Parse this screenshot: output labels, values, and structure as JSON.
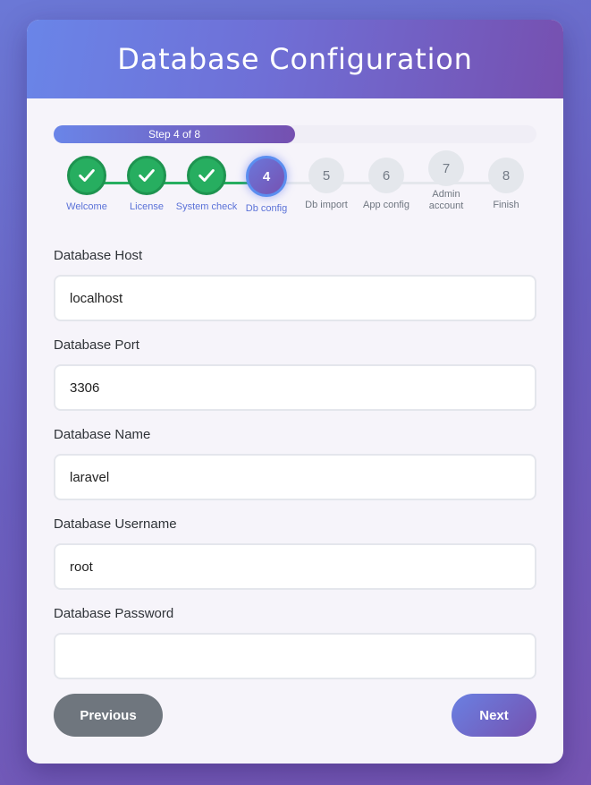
{
  "header": {
    "title": "Database Configuration"
  },
  "progress": {
    "text": "Step 4 of 8",
    "current": 4,
    "total": 8
  },
  "steps": [
    {
      "label": "Welcome",
      "number": "1",
      "state": "done"
    },
    {
      "label": "License",
      "number": "2",
      "state": "done"
    },
    {
      "label": "System check",
      "number": "3",
      "state": "done"
    },
    {
      "label": "Db config",
      "number": "4",
      "state": "active"
    },
    {
      "label": "Db import",
      "number": "5",
      "state": "pending"
    },
    {
      "label": "App config",
      "number": "6",
      "state": "pending"
    },
    {
      "label": "Admin account",
      "number": "7",
      "state": "pending"
    },
    {
      "label": "Finish",
      "number": "8",
      "state": "pending"
    }
  ],
  "form": {
    "host": {
      "label": "Database Host",
      "value": "localhost"
    },
    "port": {
      "label": "Database Port",
      "value": "3306"
    },
    "name": {
      "label": "Database Name",
      "value": "laravel"
    },
    "username": {
      "label": "Database Username",
      "value": "root"
    },
    "password": {
      "label": "Database Password",
      "value": ""
    }
  },
  "buttons": {
    "previous": "Previous",
    "next": "Next"
  },
  "colors": {
    "accent": "#6b77da",
    "done": "#27ae60",
    "pending": "#e4e7ec",
    "secondary_button": "#6f767e"
  },
  "icons": {
    "done_step": "check-icon"
  }
}
